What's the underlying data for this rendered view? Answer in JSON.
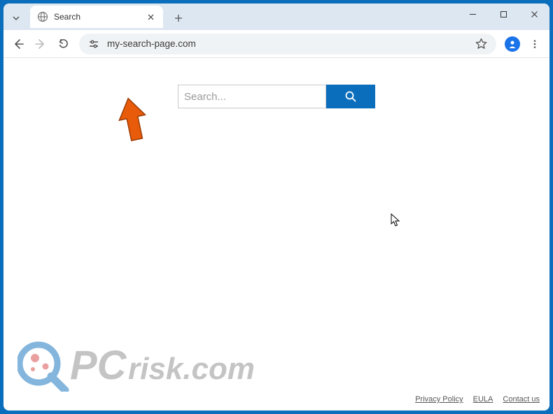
{
  "tab": {
    "title": "Search"
  },
  "omnibox": {
    "url": "my-search-page.com"
  },
  "search": {
    "placeholder": "Search..."
  },
  "footer": {
    "privacy": "Privacy Policy",
    "eula": "EULA",
    "contact": "Contact us"
  },
  "watermark": {
    "text_pc": "PC",
    "text_risk": "risk.com"
  }
}
